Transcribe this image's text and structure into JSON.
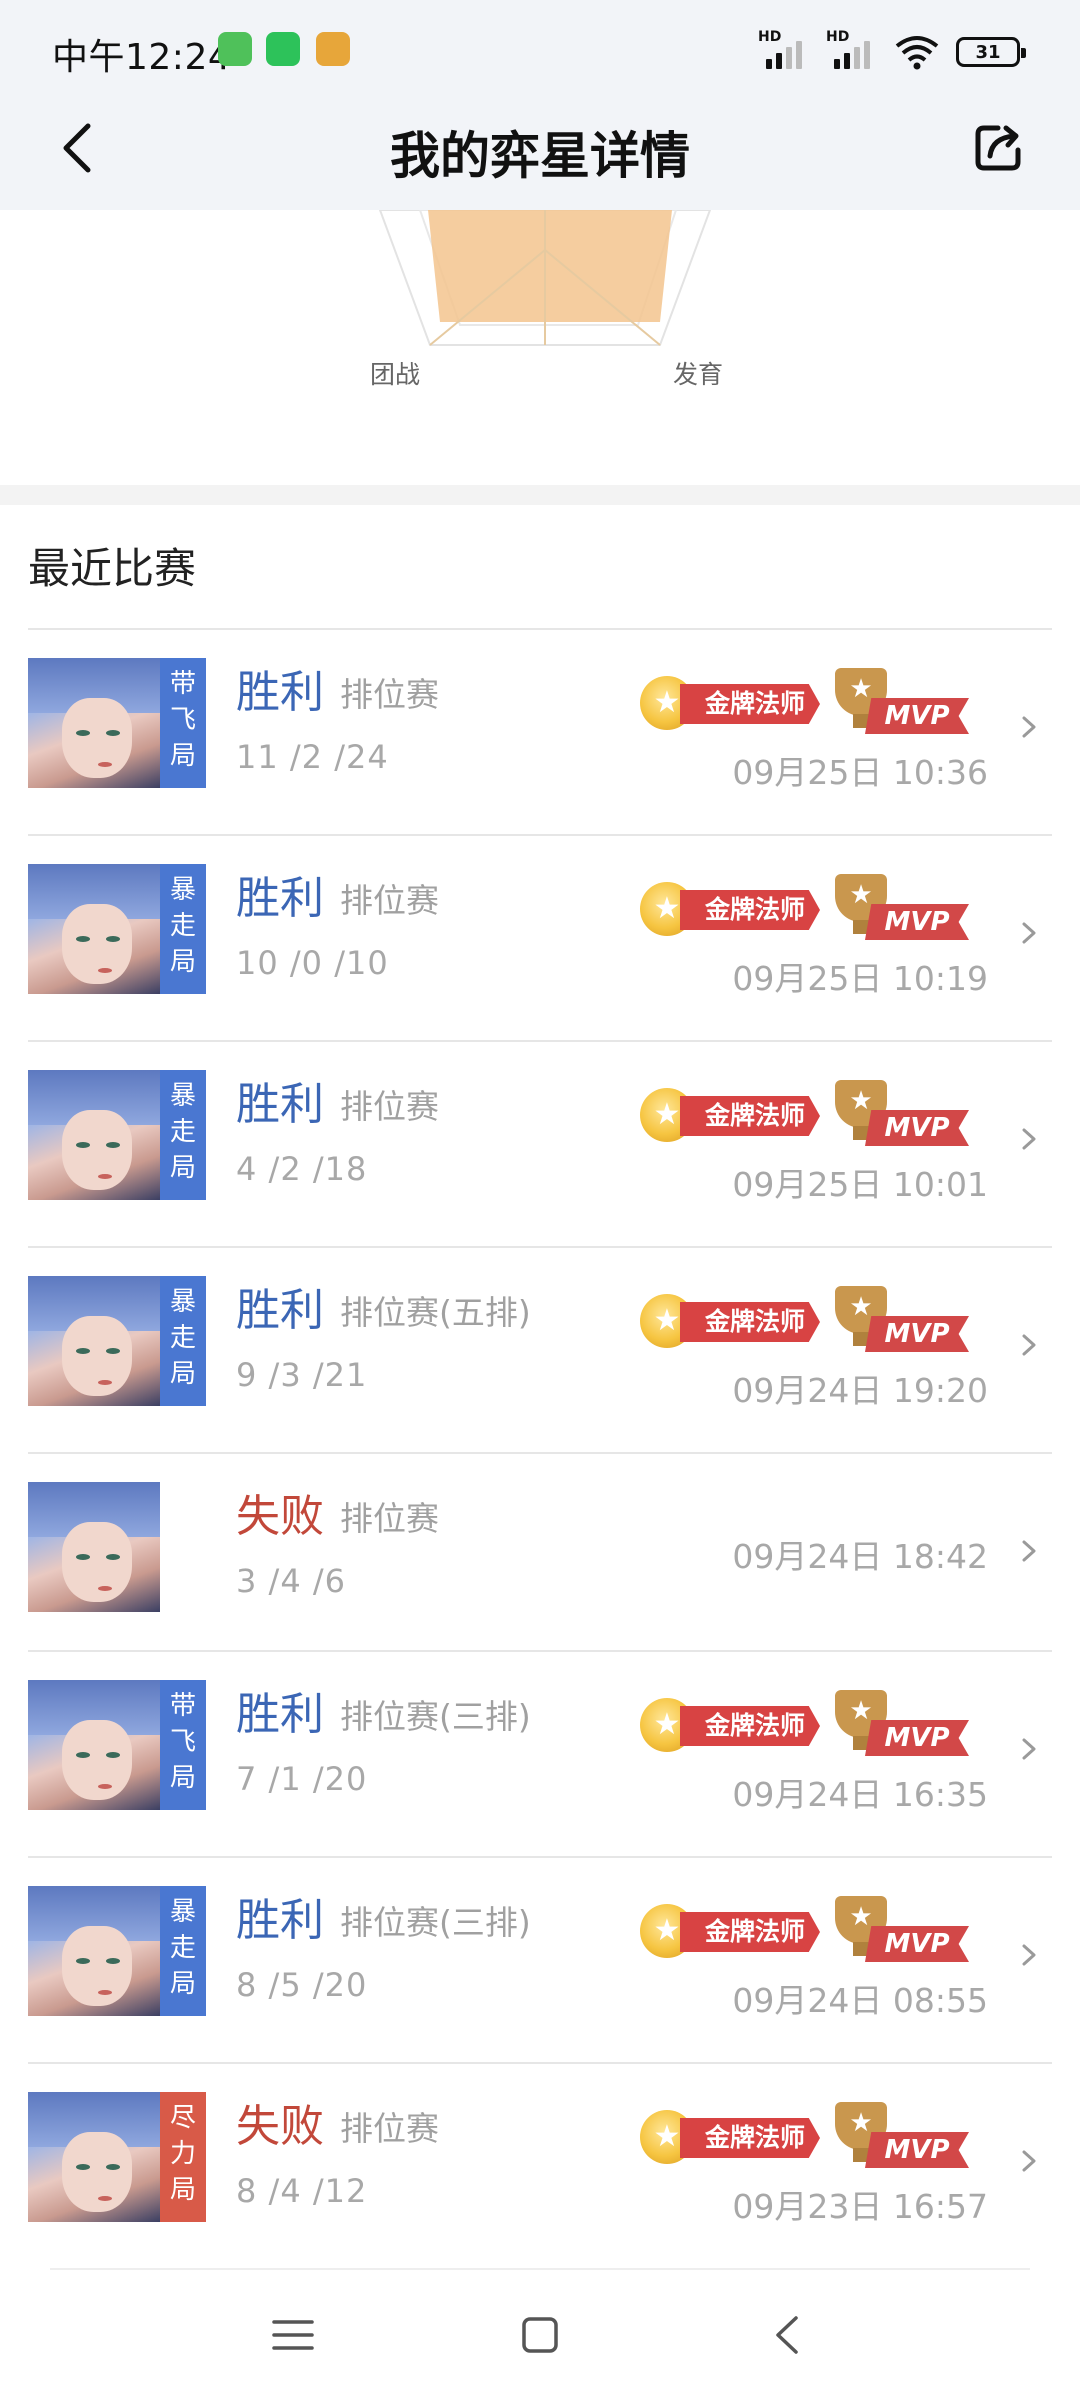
{
  "status_bar": {
    "time": "中午12:24",
    "battery": "31",
    "signal1_label": "HD",
    "signal2_label": "HD"
  },
  "header": {
    "title": "我的弈星详情"
  },
  "radar": {
    "labels": [
      "团战",
      "发育"
    ]
  },
  "section": {
    "title": "最近比赛"
  },
  "matches": [
    {
      "tag": "带飞局",
      "tag_color": "#4a77d1",
      "result": "胜利",
      "result_type": "win",
      "mode": "排位赛",
      "kda": "11 /2 /24",
      "time": "09月25日 10:36",
      "gold_badge": "金牌法师",
      "mvp": "MVP"
    },
    {
      "tag": "暴走局",
      "tag_color": "#4a77d1",
      "result": "胜利",
      "result_type": "win",
      "mode": "排位赛",
      "kda": "10 /0 /10",
      "time": "09月25日 10:19",
      "gold_badge": "金牌法师",
      "mvp": "MVP"
    },
    {
      "tag": "暴走局",
      "tag_color": "#4a77d1",
      "result": "胜利",
      "result_type": "win",
      "mode": "排位赛",
      "kda": "4 /2 /18",
      "time": "09月25日 10:01",
      "gold_badge": "金牌法师",
      "mvp": "MVP"
    },
    {
      "tag": "暴走局",
      "tag_color": "#4a77d1",
      "result": "胜利",
      "result_type": "win",
      "mode": "排位赛(五排)",
      "kda": "9 /3 /21",
      "time": "09月24日 19:20",
      "gold_badge": "金牌法师",
      "mvp": "MVP"
    },
    {
      "tag": "",
      "tag_color": "",
      "result": "失败",
      "result_type": "lose",
      "mode": "排位赛",
      "kda": "3 /4 /6",
      "time": "09月24日 18:42",
      "gold_badge": "",
      "mvp": ""
    },
    {
      "tag": "带飞局",
      "tag_color": "#4a77d1",
      "result": "胜利",
      "result_type": "win",
      "mode": "排位赛(三排)",
      "kda": "7 /1 /20",
      "time": "09月24日 16:35",
      "gold_badge": "金牌法师",
      "mvp": "MVP"
    },
    {
      "tag": "暴走局",
      "tag_color": "#4a77d1",
      "result": "胜利",
      "result_type": "win",
      "mode": "排位赛(三排)",
      "kda": "8 /5 /20",
      "time": "09月24日 08:55",
      "gold_badge": "金牌法师",
      "mvp": "MVP"
    },
    {
      "tag": "尽力局",
      "tag_color": "#d85a48",
      "result": "失败",
      "result_type": "lose",
      "mode": "排位赛",
      "kda": "8 /4 /12",
      "time": "09月23日 16:57",
      "gold_badge": "金牌法师",
      "mvp": "MVP"
    }
  ],
  "icons": {
    "back": "chevron-left-icon",
    "share": "share-icon",
    "nav_menu": "menu-icon",
    "nav_home": "square-icon",
    "nav_back": "chevron-left-icon"
  },
  "colors": {
    "win": "#3b66b5",
    "lose": "#c2483a",
    "header_bg": "#f2f4f8",
    "radar_fill": "#f3c48e"
  }
}
